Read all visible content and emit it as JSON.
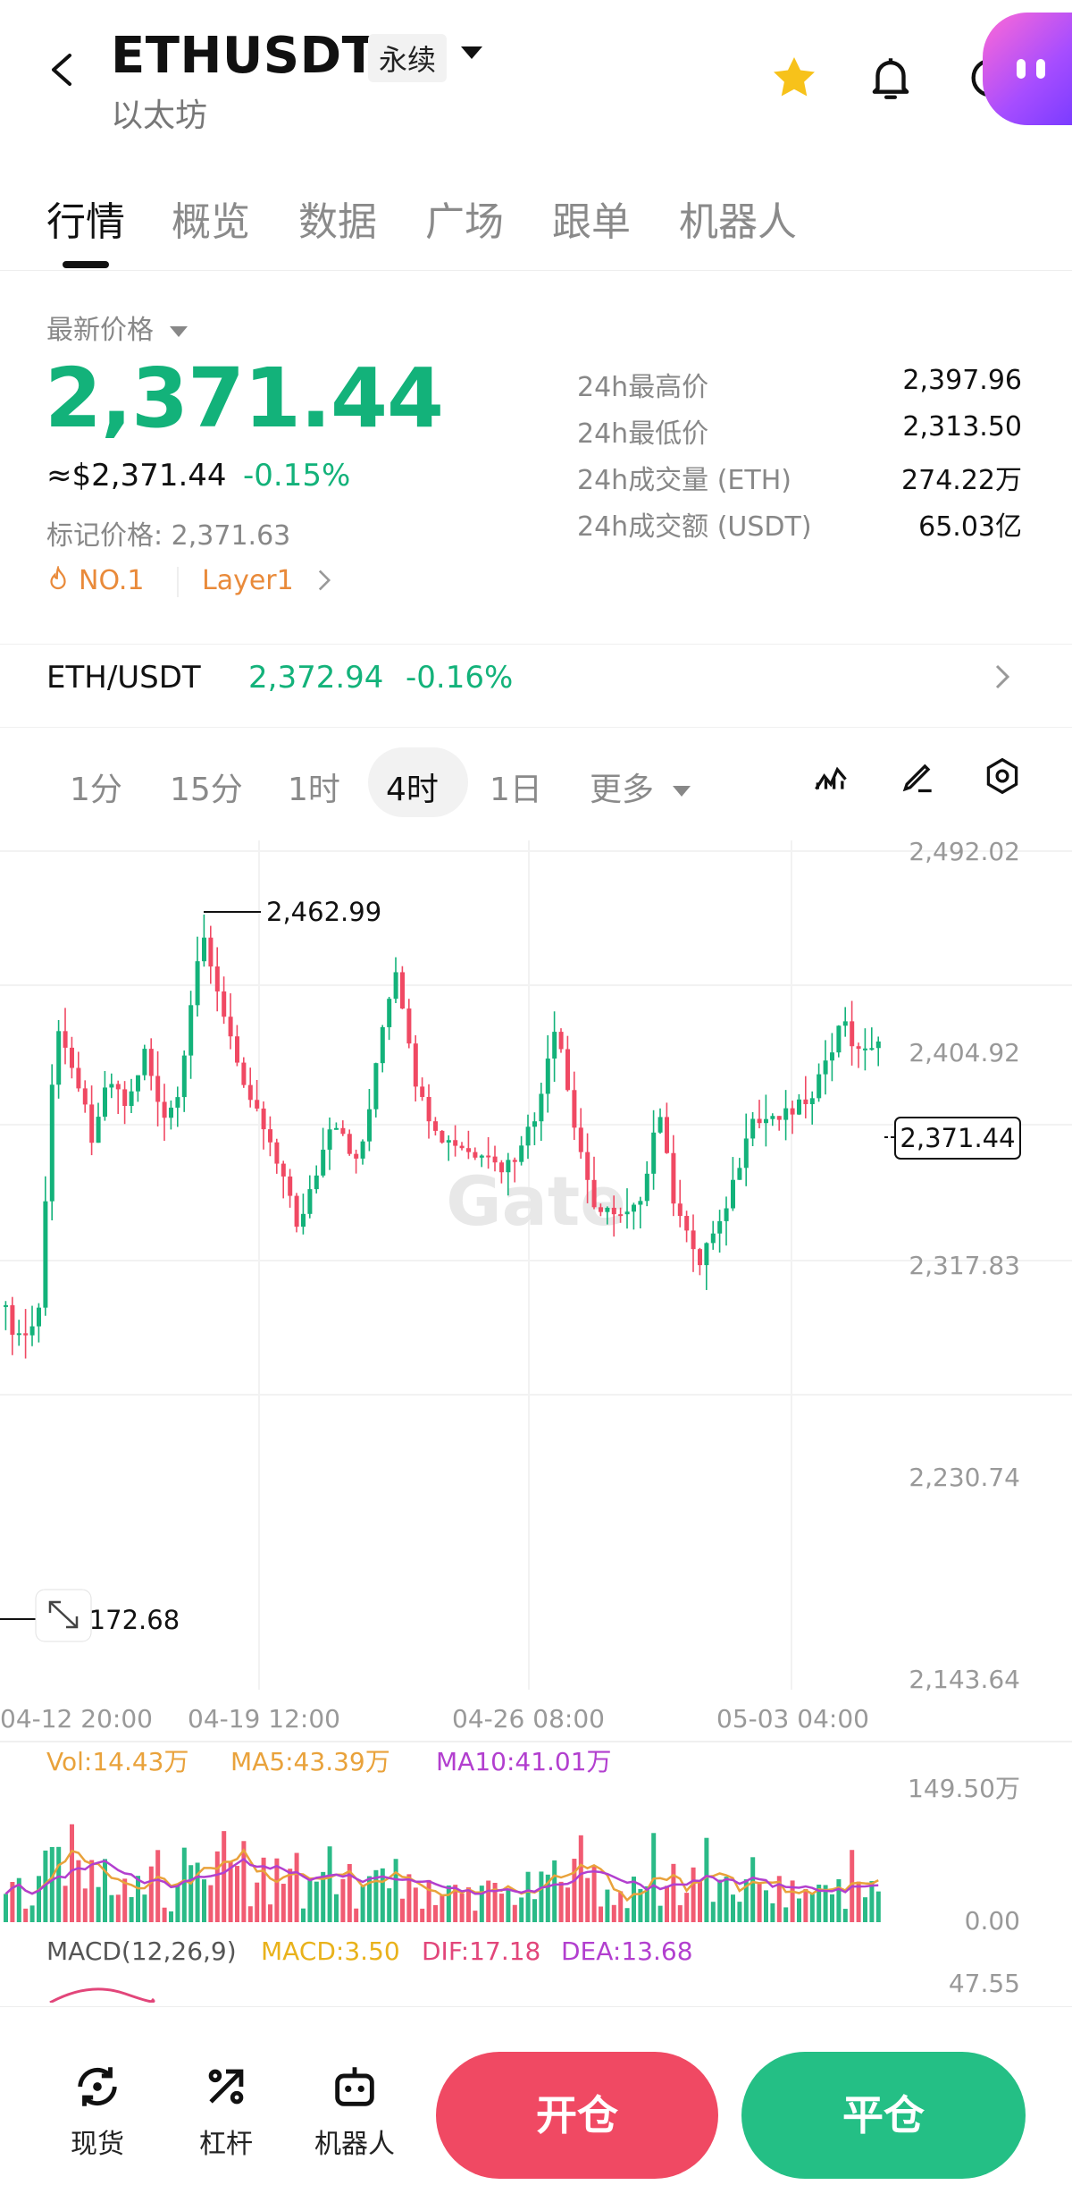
{
  "header": {
    "symbol": "ETHUSDT",
    "contract_type": "永续",
    "name": "以太坊",
    "icons": [
      "back-arrow-icon",
      "star-icon",
      "bell-icon",
      "share-icon",
      "assistant-avatar-icon"
    ]
  },
  "tabs": [
    "行情",
    "概览",
    "数据",
    "广场",
    "跟单",
    "机器人"
  ],
  "active_tab": "行情",
  "price": {
    "label": "最新价格",
    "last": "2,371.44",
    "usd": "≈$2,371.44",
    "change": "-0.15%",
    "mark": "标记价格: 2,371.63",
    "rank": "NO.1",
    "tag": "Layer1"
  },
  "stats": [
    {
      "label": "24h最高价",
      "value": "2,397.96"
    },
    {
      "label": "24h最低价",
      "value": "2,313.50"
    },
    {
      "label": "24h成交量 (ETH)",
      "value": "274.22万"
    },
    {
      "label": "24h成交额 (USDT)",
      "value": "65.03亿"
    }
  ],
  "spot_pair": {
    "pair": "ETH/USDT",
    "price": "2,372.94",
    "change": "-0.16%"
  },
  "timeframes": [
    "1分",
    "15分",
    "1时",
    "4时",
    "1日",
    "更多"
  ],
  "active_timeframe": "4时",
  "chart_data": {
    "type": "candlestick",
    "y_axis_labels": [
      "2,492.02",
      "2,404.92",
      "2,317.83",
      "2,230.74",
      "2,143.64"
    ],
    "ylim": [
      2143.64,
      2492.02
    ],
    "x_axis_labels": [
      "04-12 20:00",
      "04-19 12:00",
      "04-26 08:00",
      "05-03 04:00"
    ],
    "high_marker": "2,462.99",
    "low_marker": "2,172.68",
    "last_price_tag": "2,371.44",
    "watermark": "Gate",
    "volume": {
      "label": "Vol:14.43万",
      "ma5": "MA5:43.39万",
      "ma10": "MA10:41.01万",
      "max_label": "149.50万",
      "min_label": "0.00"
    },
    "macd": {
      "label": "MACD(12,26,9)",
      "macd": "MACD:3.50",
      "dif": "DIF:17.18",
      "dea": "DEA:13.68",
      "max_label": "47.55"
    }
  },
  "colors": {
    "up": "#13b27a",
    "down": "#f04963",
    "ma5": "#e9a23b",
    "ma10": "#b23fcf"
  },
  "bottom_nav": [
    {
      "label": "现货",
      "icon": "spot-icon"
    },
    {
      "label": "杠杆",
      "icon": "margin-icon"
    },
    {
      "label": "机器人",
      "icon": "bot-icon"
    }
  ],
  "actions": {
    "open": "开仓",
    "close": "平仓"
  }
}
